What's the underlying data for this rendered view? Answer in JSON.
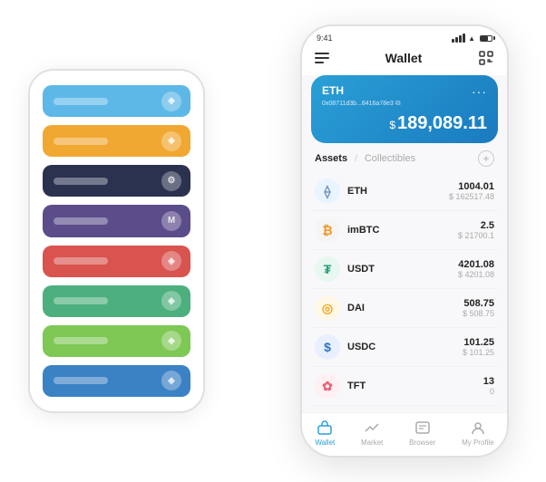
{
  "scene": {
    "bgPhone": {
      "strips": [
        {
          "id": "blue-light",
          "color": "#5db8e8",
          "label": "",
          "iconText": "◈"
        },
        {
          "id": "orange",
          "color": "#f0a832",
          "label": "",
          "iconText": "◈"
        },
        {
          "id": "dark-navy",
          "color": "#2b3250",
          "label": "",
          "iconText": "⚙"
        },
        {
          "id": "purple",
          "color": "#5b4d8a",
          "label": "",
          "iconText": "M"
        },
        {
          "id": "red",
          "color": "#d9534f",
          "label": "",
          "iconText": "◈"
        },
        {
          "id": "green",
          "color": "#4caf7d",
          "label": "",
          "iconText": "◈"
        },
        {
          "id": "light-green",
          "color": "#7ec855",
          "label": "",
          "iconText": "◈"
        },
        {
          "id": "blue",
          "color": "#3b82c4",
          "label": "",
          "iconText": "◈"
        }
      ]
    },
    "mainPhone": {
      "status": {
        "time": "9:41",
        "signal": true,
        "wifi": true,
        "battery": true
      },
      "header": {
        "menu_icon": "☰",
        "title": "Wallet",
        "scan_icon": "⇔"
      },
      "card": {
        "coin": "ETH",
        "address": "0x08711d3b...8416a78e3",
        "copy_icon": "⧉",
        "balance_prefix": "$",
        "balance": "189,089.11",
        "dots": "···"
      },
      "assets": {
        "tab_active": "Assets",
        "tab_divider": "/",
        "tab_inactive": "Collectibles",
        "add_icon": "+"
      },
      "assetList": [
        {
          "id": "eth",
          "icon": "⟠",
          "icon_class": "icon-eth",
          "name": "ETH",
          "amount": "1004.01",
          "usd": "$ 162517.48"
        },
        {
          "id": "imbtc",
          "icon": "₿",
          "icon_class": "icon-imbtc",
          "name": "imBTC",
          "amount": "2.5",
          "usd": "$ 2170​0.1"
        },
        {
          "id": "usdt",
          "icon": "₮",
          "icon_class": "icon-usdt",
          "name": "USDT",
          "amount": "4201.08",
          "usd": "$ 4201.08"
        },
        {
          "id": "dai",
          "icon": "◎",
          "icon_class": "icon-dai",
          "name": "DAI",
          "amount": "508.75",
          "usd": "$ 508.75"
        },
        {
          "id": "usdc",
          "icon": "$",
          "icon_class": "icon-usdc",
          "name": "USDC",
          "amount": "101.25",
          "usd": "$ 101.25"
        },
        {
          "id": "tft",
          "icon": "✿",
          "icon_class": "icon-tft",
          "name": "TFT",
          "amount": "13",
          "usd": "0"
        }
      ],
      "bottomNav": [
        {
          "id": "wallet",
          "label": "Wallet",
          "active": true
        },
        {
          "id": "market",
          "label": "Market",
          "active": false
        },
        {
          "id": "browser",
          "label": "Browser",
          "active": false
        },
        {
          "id": "profile",
          "label": "My Profile",
          "active": false
        }
      ]
    }
  }
}
